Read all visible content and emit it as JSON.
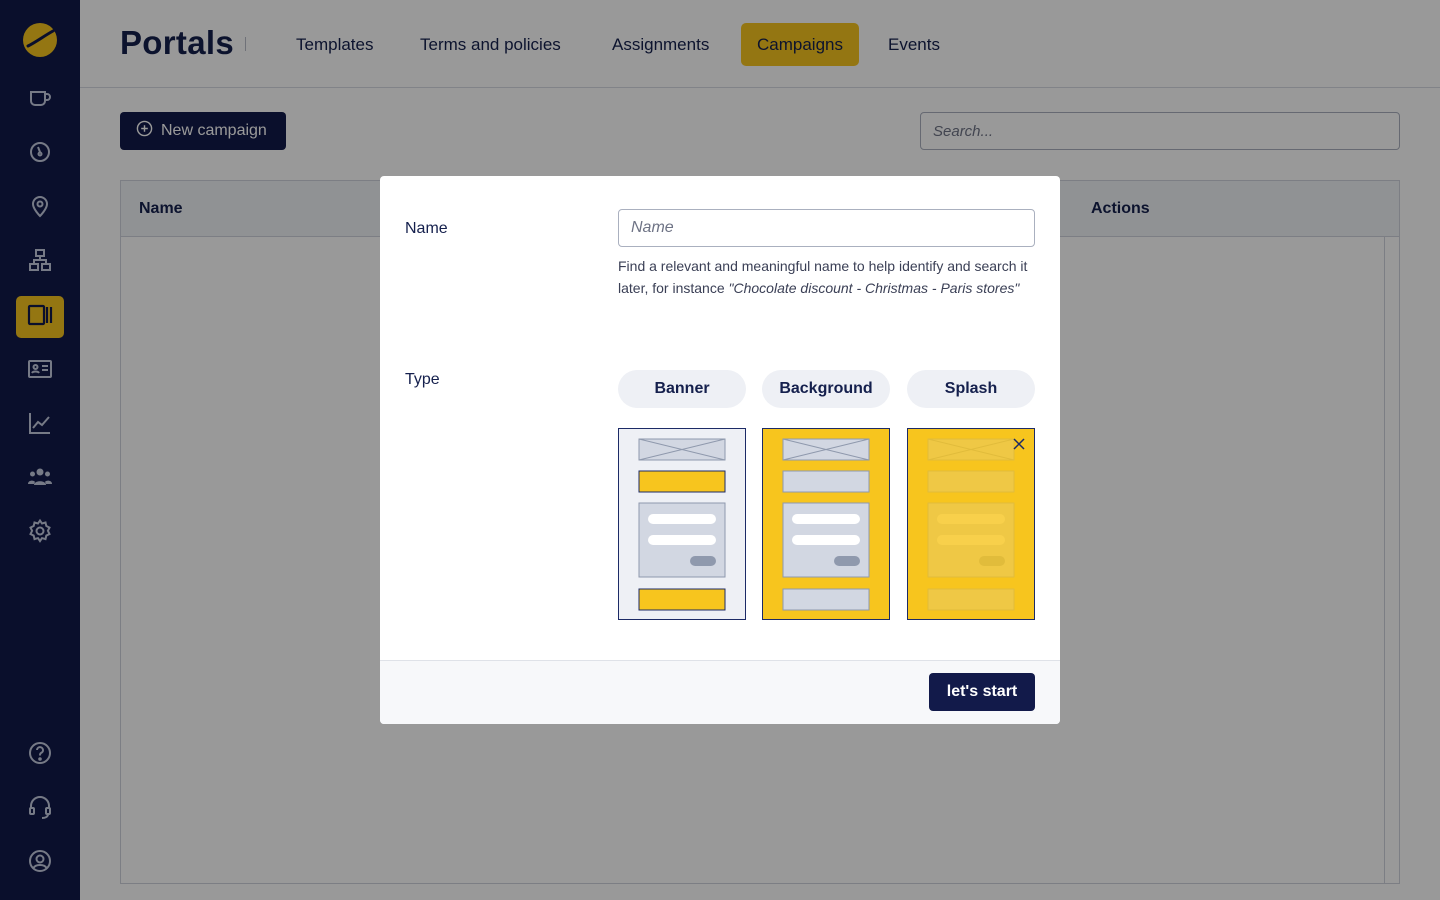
{
  "app": {
    "title": "Portals"
  },
  "colors": {
    "sidebar_bg": "#121a4a",
    "accent": "#f7c51e",
    "primary_button": "#121a4a",
    "text": "#15204d"
  },
  "sidebar": {
    "logo_icon": "brand-logo-icon",
    "items": [
      {
        "icon": "cup-icon",
        "active": false
      },
      {
        "icon": "gauge-icon",
        "active": false
      },
      {
        "icon": "location-pin-icon",
        "active": false
      },
      {
        "icon": "network-icon",
        "active": false
      },
      {
        "icon": "portal-icon",
        "active": true
      },
      {
        "icon": "id-card-icon",
        "active": false
      },
      {
        "icon": "chart-line-icon",
        "active": false
      },
      {
        "icon": "users-icon",
        "active": false
      },
      {
        "icon": "gear-icon",
        "active": false
      }
    ],
    "bottom_items": [
      {
        "icon": "help-icon"
      },
      {
        "icon": "headset-icon"
      },
      {
        "icon": "user-circle-icon"
      }
    ]
  },
  "header": {
    "tabs": [
      {
        "label": "Templates",
        "active": false
      },
      {
        "label": "Terms and policies",
        "active": false
      },
      {
        "label": "Assignments",
        "active": false
      },
      {
        "label": "Campaigns",
        "active": true
      },
      {
        "label": "Events",
        "active": false
      }
    ]
  },
  "toolbar": {
    "new_button_label": "New campaign",
    "search_placeholder": "Search..."
  },
  "table": {
    "columns": [
      "Name",
      "Actions"
    ]
  },
  "modal": {
    "name_label": "Name",
    "name_placeholder": "Name",
    "help_text_prefix": "Find a relevant and meaningful name to help identify and search it later, for instance ",
    "help_text_example": "\"Chocolate discount - Christmas - Paris stores\"",
    "type_label": "Type",
    "types": [
      {
        "label": "Banner",
        "selected": false
      },
      {
        "label": "Background",
        "selected": false
      },
      {
        "label": "Splash",
        "selected": false
      }
    ],
    "start_button_label": "let's start"
  }
}
